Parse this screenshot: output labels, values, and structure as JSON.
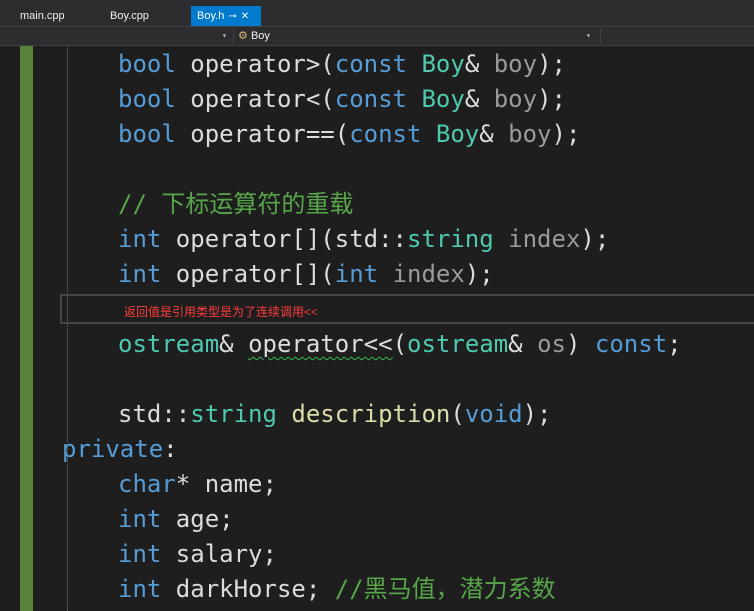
{
  "tabs": [
    {
      "label": "main.cpp",
      "active": false
    },
    {
      "label": "Boy.cpp",
      "active": false
    },
    {
      "label": "Boy.h",
      "active": true
    }
  ],
  "tab_icons": [
    "pin-icon",
    "close-icon"
  ],
  "navbar": {
    "scope_label": "Boy"
  },
  "code": {
    "l1": {
      "t1": "bool",
      "t2": " operator>(",
      "t3": "const",
      "t4": " ",
      "t5": "Boy",
      "t6": "& ",
      "t7": "boy",
      "t8": ");"
    },
    "l2": {
      "t1": "bool",
      "t2": " operator<(",
      "t3": "const",
      "t4": " ",
      "t5": "Boy",
      "t6": "& ",
      "t7": "boy",
      "t8": ");"
    },
    "l3": {
      "t1": "bool",
      "t2": " operator==(",
      "t3": "const",
      "t4": " ",
      "t5": "Boy",
      "t6": "& ",
      "t7": "boy",
      "t8": ");"
    },
    "l4": {
      "t1": "// 下标运算符的重载"
    },
    "l5": {
      "t1": "int",
      "t2": " operator[](std::",
      "t3": "string",
      "t4": " ",
      "t5": "index",
      "t6": ");"
    },
    "l6": {
      "t1": "int",
      "t2": " operator[](",
      "t3": "int",
      "t4": " ",
      "t5": "index",
      "t6": ");"
    },
    "hint": "返回值是引用类型是为了连续调用<<",
    "l7": {
      "t1": "ostream",
      "t2": "& ",
      "t3": "operator<<",
      "t4": "(",
      "t5": "ostream",
      "t6": "& ",
      "t7": "os",
      "t8": ") ",
      "t9": "const",
      "t10": ";"
    },
    "l8": {
      "t1": "std::",
      "t2": "string",
      "t3": " ",
      "t4": "description",
      "t5": "(",
      "t6": "void",
      "t7": ");"
    },
    "l9": {
      "t1": "private",
      "t2": ":"
    },
    "l10": {
      "t1": "char",
      "t2": "* name;"
    },
    "l11": {
      "t1": "int",
      "t2": " age;"
    },
    "l12": {
      "t1": "int",
      "t2": " salary;"
    },
    "l13": {
      "t1": "int",
      "t2": " darkHorse; ",
      "t3": "//黑马值，潜力系数"
    }
  },
  "colors": {
    "keyword": "#569cd6",
    "type": "#4ec9b0",
    "comment": "#57a64a",
    "param": "#9a9a9a",
    "function": "#dcdcaa",
    "hint": "#ff3c3c",
    "accent": "#007acc",
    "change_bar": "#58813c"
  }
}
